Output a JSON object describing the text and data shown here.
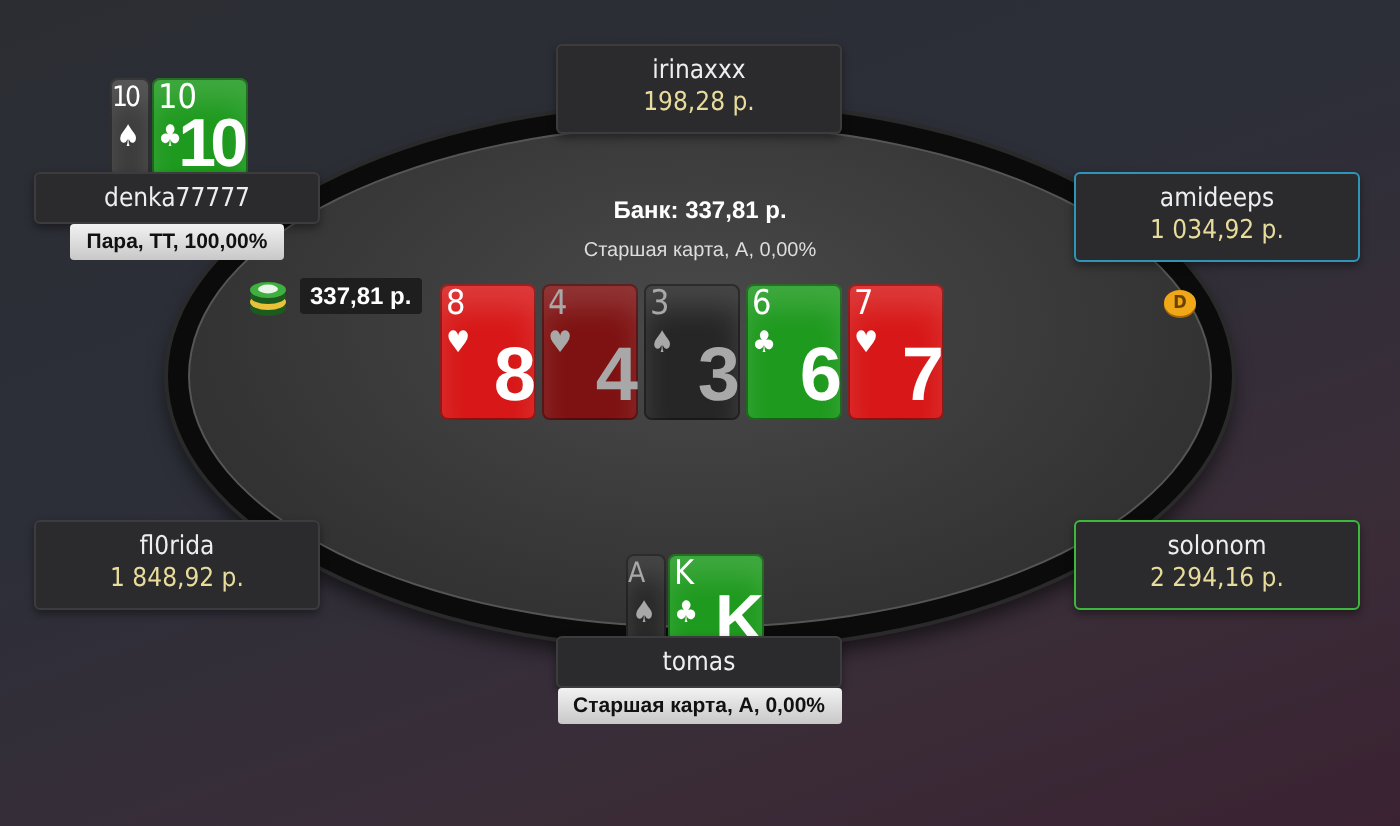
{
  "pot": {
    "label": "Банк: 337,81 р.",
    "hand": "Старшая карта, A, 0,00%"
  },
  "board": [
    {
      "rank": "8",
      "suit": "♥",
      "center_rank": "8",
      "color": "#d81818",
      "dimmed": false
    },
    {
      "rank": "4",
      "suit": "♥",
      "center_rank": "4",
      "color": "#7e1212",
      "dimmed": true
    },
    {
      "rank": "3",
      "suit": "♠",
      "center_rank": "3",
      "color": "#262626",
      "dimmed": true
    },
    {
      "rank": "6",
      "suit": "♣",
      "center_rank": "6",
      "color": "#1e9a1e",
      "dimmed": false
    },
    {
      "rank": "7",
      "suit": "♥",
      "center_rank": "7",
      "color": "#d81818",
      "dimmed": false
    }
  ],
  "seats": [
    {
      "name": "irinaxxx",
      "stack": "198,28 р."
    },
    {
      "name": "denka77777",
      "hand": "Пара, TT, 100,00%",
      "bet": "337,81 р.",
      "cards": [
        {
          "rank": "10",
          "suit": "♠",
          "color": "#3a3a3a",
          "dimmed": false
        },
        {
          "rank": "10",
          "suit": "♣",
          "center_rank": "10",
          "color": "#1e9a1e",
          "dimmed": false
        }
      ]
    },
    {
      "name": "amideeps",
      "stack": "1 034,92 р.",
      "color": "#2f95b8",
      "dealer": "D"
    },
    {
      "name": "fl0rida",
      "stack": "1 848,92 р."
    },
    {
      "name": "solonom",
      "stack": "2 294,16 р.",
      "color": "#3cb83c"
    },
    {
      "name": "tomas",
      "hand": "Старшая карта, A, 0,00%",
      "cards": [
        {
          "rank": "A",
          "suit": "♠",
          "color": "#262626",
          "dimmed": true
        },
        {
          "rank": "K",
          "suit": "♣",
          "center_rank": "K",
          "color": "#1e9a1e",
          "dimmed": false
        }
      ]
    }
  ]
}
